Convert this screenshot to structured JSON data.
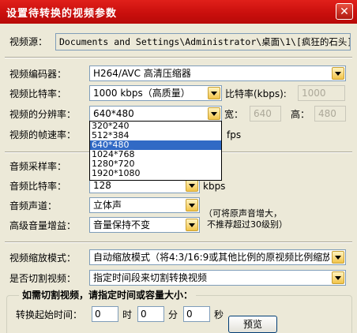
{
  "window": {
    "title": "设置待转换的视频参数",
    "close": "✕"
  },
  "video_source": {
    "label": "视频源：",
    "value": "Documents and Settings\\Administrator\\桌面\\1\\[疯狂的石头].AVI"
  },
  "video_encoder": {
    "label": "视频编码器：",
    "value": "H264/AVC 高清压缩器"
  },
  "video_bitrate": {
    "label": "视频比特率：",
    "value": "1000 kbps（高质量）",
    "kbps_label": "比特率(kbps):",
    "kbps_value": "1000"
  },
  "resolution": {
    "label": "视频的分辨率：",
    "value": "640*480",
    "width_label": "宽：",
    "width_value": "640",
    "height_label": "高：",
    "height_value": "480",
    "options": [
      "320*240",
      "512*384",
      "640*480",
      "1024*768",
      "1280*720",
      "1920*1080"
    ],
    "selected_index": 2
  },
  "framerate": {
    "label": "视频的帧速率：",
    "unit": "fps"
  },
  "audio_samplerate": {
    "label": "音频采样率："
  },
  "audio_bitrate": {
    "label": "音频比特率：",
    "value": "128",
    "unit": "kbps"
  },
  "audio_channel": {
    "label": "音频声道：",
    "value": "立体声",
    "note_line1": "（可将原声音增大，",
    "note_line2": "不推荐超过30级别）"
  },
  "volume_gain": {
    "label": "高级音量增益：",
    "value": "音量保持不变"
  },
  "scale_mode": {
    "label": "视频缩放模式：",
    "value": "自动缩放模式（将4:3/16:9或其他比例的原视频比例缩放"
  },
  "cut_video": {
    "label": "是否切割视频：",
    "value": "指定时间段来切割转换视频"
  },
  "cut_group": {
    "title": "如需切割视频，请指定时间或容量大小：",
    "start_label": "转换起始时间：",
    "hour_value": "0",
    "hour_unit": "时",
    "minute_value": "0",
    "minute_unit": "分",
    "second_value": "0",
    "second_unit": "秒",
    "preview_button": "预览"
  }
}
